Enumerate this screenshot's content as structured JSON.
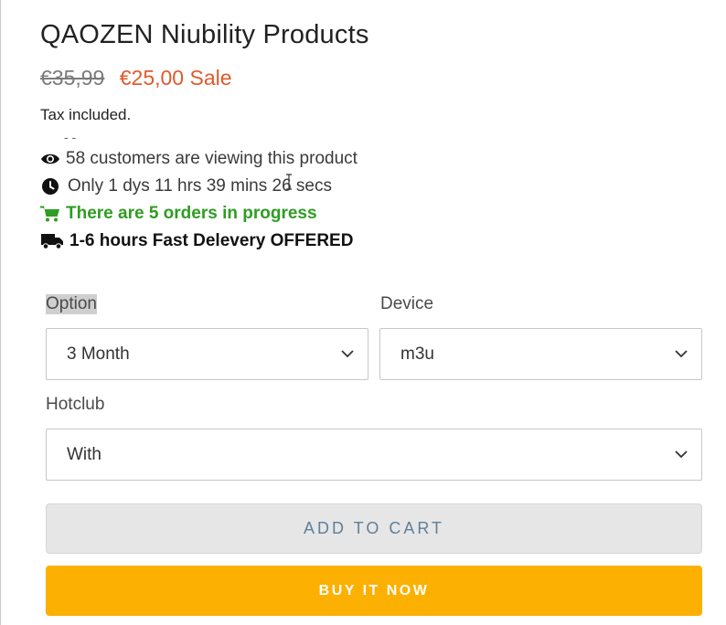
{
  "product": {
    "title": "QAOZEN Niubility Products",
    "old_price": "€35,99",
    "new_price": "€25,00 Sale",
    "tax_note": "Tax included.",
    "dots": "- -",
    "viewers": "58 customers are viewing this product",
    "timer": "Only 1 dys 11 hrs 39 mins 26 secs",
    "orders": "There are 5 orders in progress",
    "delivery": "1-6 hours Fast Delevery OFFERED"
  },
  "options": {
    "option_label": "Option",
    "option_value": "3 Month",
    "device_label": "Device",
    "device_value": "m3u",
    "hotclub_label": "Hotclub",
    "hotclub_value": "With"
  },
  "buttons": {
    "add_to_cart": "Add to cart",
    "buy_now": "Buy it now"
  },
  "icons": {
    "viewers": "eye-icon",
    "timer": "clock-icon",
    "orders": "shopping-cart-icon",
    "delivery": "truck-icon",
    "select": "chevron-down-icon"
  },
  "colors": {
    "sale_price": "#e05a2b",
    "orders_text": "#2e9d22",
    "buy_button": "#fcb002",
    "cart_button": "#e6e6e6"
  }
}
